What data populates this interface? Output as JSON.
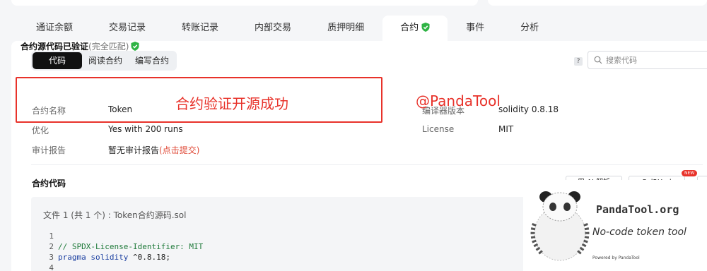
{
  "tabs": [
    {
      "label": "通证余额"
    },
    {
      "label": "交易记录"
    },
    {
      "label": "转账记录"
    },
    {
      "label": "内部交易"
    },
    {
      "label": "质押明细"
    },
    {
      "label": "合约",
      "active": true
    },
    {
      "label": "事件"
    },
    {
      "label": "分析"
    }
  ],
  "segment": {
    "items": [
      "代码",
      "阅读合约",
      "编写合约"
    ],
    "active": "代码"
  },
  "help_label": "?",
  "search": {
    "placeholder": "搜索代码"
  },
  "verified": {
    "title": "合约源代码已验证",
    "subtitle": "(完全匹配)"
  },
  "info": {
    "contract_name_label": "合约名称",
    "contract_name_value": "Token",
    "optimization_label": "优化",
    "optimization_value": "Yes with 200 runs",
    "audit_label": "审计报告",
    "audit_value": "暂无审计报告",
    "audit_link": "(点击提交)",
    "compiler_label": "编译器版本",
    "compiler_value": "solidity 0.8.18",
    "license_label": "License",
    "license_value": "MIT"
  },
  "annotation": {
    "text": "合约验证开源成功",
    "watermark": "@PandaTool"
  },
  "code_section": {
    "title": "合约代码",
    "ai_button": "用 AI 解析",
    "sol2uml_button": "Sol2Uml",
    "new_badge": "NEW",
    "file_line": "文件 1 (共 1 个) : Token合约源码.sol",
    "lines": [
      {
        "n": "1",
        "text": ""
      },
      {
        "n": "2",
        "text": "// SPDX-License-Identifier: MIT"
      },
      {
        "n": "3",
        "kw": "pragma solidity",
        "rest": " ^0.8.18;"
      },
      {
        "n": "4",
        "text": ""
      }
    ]
  },
  "brand": {
    "name": "PandaTool.org",
    "tagline": "No-code token tool",
    "small": "Powered by PandaTool"
  },
  "colors": {
    "accent": "#e8322a",
    "verified_green": "#2fb344",
    "active_dark": "#111111"
  }
}
